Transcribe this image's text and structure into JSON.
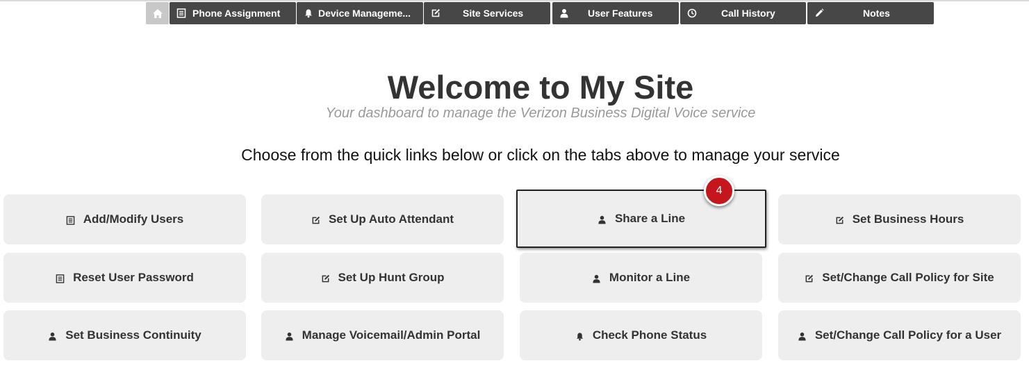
{
  "nav": {
    "tabs": [
      {
        "label": "",
        "icon": "home-icon"
      },
      {
        "label": "Phone Assignment",
        "icon": "list-icon"
      },
      {
        "label": "Device Manageme...",
        "icon": "bell-icon"
      },
      {
        "label": "Site Services",
        "icon": "edit-icon"
      },
      {
        "label": "User Features",
        "icon": "user-icon"
      },
      {
        "label": "Call History",
        "icon": "clock-icon"
      },
      {
        "label": "Notes",
        "icon": "pencil-icon"
      }
    ]
  },
  "header": {
    "title": "Welcome to My Site",
    "subtitle": "Your dashboard to manage the Verizon Business Digital Voice service",
    "instruction": "Choose from the quick links below or click on the tabs above to manage your service"
  },
  "quick_links": [
    {
      "label": "Add/Modify Users",
      "icon": "list-icon"
    },
    {
      "label": "Set Up Auto Attendant",
      "icon": "edit-icon"
    },
    {
      "label": "Share a Line",
      "icon": "user-icon"
    },
    {
      "label": "Set Business Hours",
      "icon": "edit-icon"
    },
    {
      "label": "Reset User Password",
      "icon": "list-icon"
    },
    {
      "label": "Set Up Hunt Group",
      "icon": "edit-icon"
    },
    {
      "label": "Monitor a Line",
      "icon": "user-icon"
    },
    {
      "label": "Set/Change Call Policy for Site",
      "icon": "edit-icon"
    },
    {
      "label": "Set Business Continuity",
      "icon": "user-icon"
    },
    {
      "label": "Manage Voicemail/Admin Portal",
      "icon": "user-icon"
    },
    {
      "label": "Check Phone Status",
      "icon": "bell-icon"
    },
    {
      "label": "Set/Change Call Policy for a User",
      "icon": "user-icon"
    }
  ],
  "step_badge": "4",
  "colors": {
    "tab_bg": "#474747",
    "home_tab_bg": "#c8c8c8",
    "button_bg": "#eeeeee",
    "badge": "#c4161c"
  }
}
